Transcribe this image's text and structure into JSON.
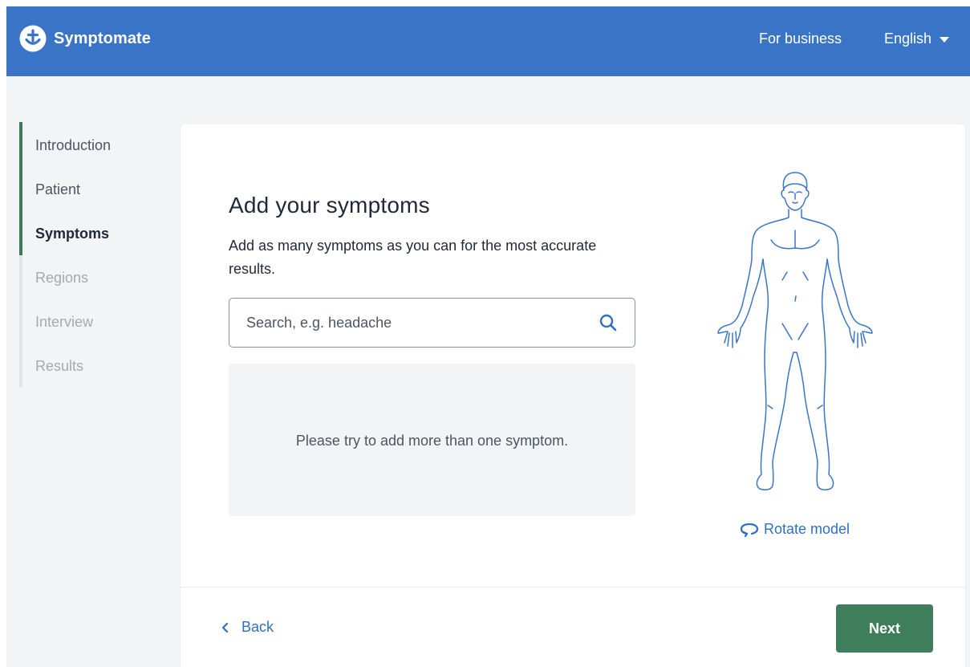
{
  "header": {
    "brand": "Symptomate",
    "brand_icon": "symptomate-logo-icon",
    "for_business": "For business",
    "language": "English",
    "language_icon": "caret-down-icon",
    "bg_color": "#3a74c7"
  },
  "nav": {
    "items": [
      {
        "label": "Introduction",
        "state": "done"
      },
      {
        "label": "Patient",
        "state": "done"
      },
      {
        "label": "Symptoms",
        "state": "current"
      },
      {
        "label": "Regions",
        "state": "todo"
      },
      {
        "label": "Interview",
        "state": "todo"
      },
      {
        "label": "Results",
        "state": "todo"
      }
    ],
    "progress_color": "#3d7a57"
  },
  "main": {
    "title": "Add your symptoms",
    "description": "Add as many symptoms as you can for the most accurate results.",
    "search": {
      "placeholder": "Search, e.g. headache",
      "value": "",
      "icon": "search-icon"
    },
    "empty_message": "Please try to add more than one symptom.",
    "rotate_label": "Rotate model",
    "rotate_icon": "rotate-icon"
  },
  "footer": {
    "back_label": "Back",
    "back_icon": "chevron-left-icon",
    "next_label": "Next",
    "next_color": "#3f7e5b"
  }
}
